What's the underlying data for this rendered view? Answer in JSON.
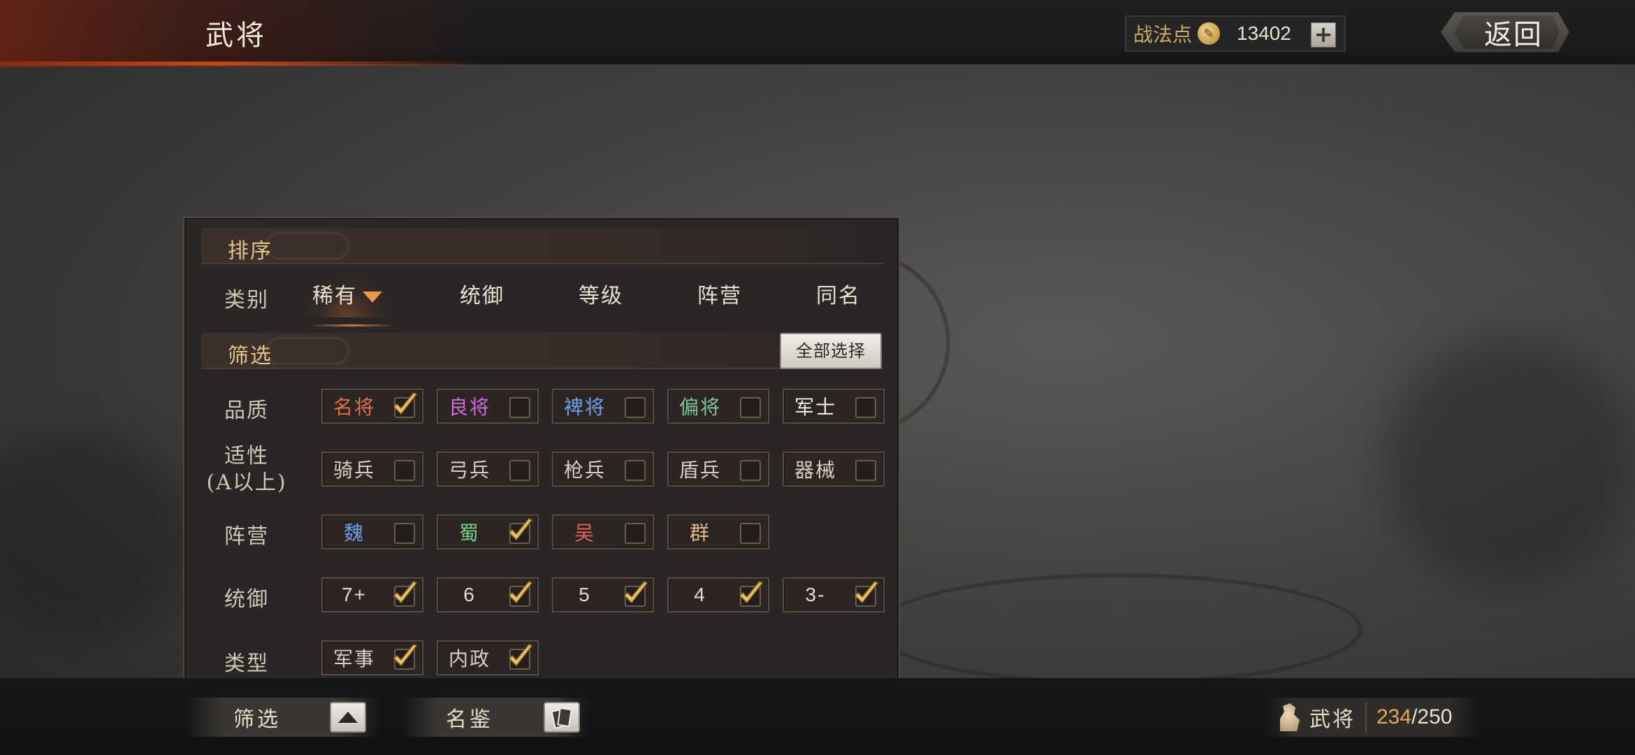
{
  "header": {
    "title": "武将",
    "points_label": "战法点",
    "points_icon": "quill-coin-icon",
    "points_value": "13402",
    "add_label": "+",
    "back_label": "返回"
  },
  "panel": {
    "sort_section": "排序",
    "sort_row_label": "类别",
    "sort_options": [
      "稀有",
      "统御",
      "等级",
      "阵营",
      "同名"
    ],
    "active_sort": "稀有",
    "filter_section": "筛选",
    "select_all_label": "全部选择",
    "rows": [
      {
        "label": "品质",
        "options": [
          {
            "text": "名将",
            "checked": true,
            "color": "#e0704a"
          },
          {
            "text": "良将",
            "checked": false,
            "color": "#d36ae0"
          },
          {
            "text": "裨将",
            "checked": false,
            "color": "#6fa0e8"
          },
          {
            "text": "偏将",
            "checked": false,
            "color": "#7cc79a"
          },
          {
            "text": "军士",
            "checked": false,
            "color": "#ecebea"
          }
        ]
      },
      {
        "label": "适性",
        "label2": "(A以上)",
        "options": [
          {
            "text": "骑兵",
            "checked": false,
            "color": "#d8cfc0"
          },
          {
            "text": "弓兵",
            "checked": false,
            "color": "#d8cfc0"
          },
          {
            "text": "枪兵",
            "checked": false,
            "color": "#d8cfc0"
          },
          {
            "text": "盾兵",
            "checked": false,
            "color": "#d8cfc0"
          },
          {
            "text": "器械",
            "checked": false,
            "color": "#d8cfc0"
          }
        ]
      },
      {
        "label": "阵营",
        "options": [
          {
            "text": "魏",
            "checked": false,
            "color": "#6f9fe6"
          },
          {
            "text": "蜀",
            "checked": true,
            "color": "#76c98a"
          },
          {
            "text": "吴",
            "checked": false,
            "color": "#e0665a"
          },
          {
            "text": "群",
            "checked": false,
            "color": "#e0b88a"
          }
        ]
      },
      {
        "label": "统御",
        "options": [
          {
            "text": "7+",
            "checked": true,
            "color": "#e4dccc"
          },
          {
            "text": "6",
            "checked": true,
            "color": "#e4dccc"
          },
          {
            "text": "5",
            "checked": true,
            "color": "#e4dccc"
          },
          {
            "text": "4",
            "checked": true,
            "color": "#e4dccc"
          },
          {
            "text": "3-",
            "checked": true,
            "color": "#e4dccc"
          }
        ]
      },
      {
        "label": "类型",
        "options": [
          {
            "text": "军事",
            "checked": true,
            "color": "#d8cfc0"
          },
          {
            "text": "内政",
            "checked": true,
            "color": "#d8cfc0"
          }
        ]
      }
    ]
  },
  "bottom": {
    "filter_tab": "筛选",
    "gallery_tab": "名鉴",
    "generals_label": "武将",
    "generals_current": "234",
    "generals_total": "/250"
  },
  "colors": {
    "accent_gold": "#e3c487",
    "count_orange": "#e4a85a",
    "check_gold": "#e8c46a"
  }
}
